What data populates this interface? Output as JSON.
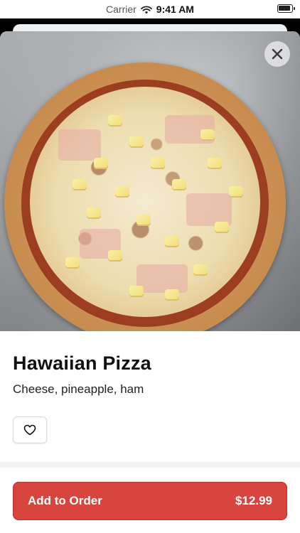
{
  "status_bar": {
    "carrier": "Carrier",
    "time": "9:41 AM"
  },
  "product": {
    "title": "Hawaiian Pizza",
    "description": "Cheese, pineapple, ham"
  },
  "actions": {
    "add_label": "Add to Order",
    "price": "$12.99"
  },
  "icons": {
    "close": "close-icon",
    "favorite": "heart-icon",
    "wifi": "wifi-icon",
    "battery": "battery-icon"
  },
  "colors": {
    "accent": "#d8453e"
  }
}
